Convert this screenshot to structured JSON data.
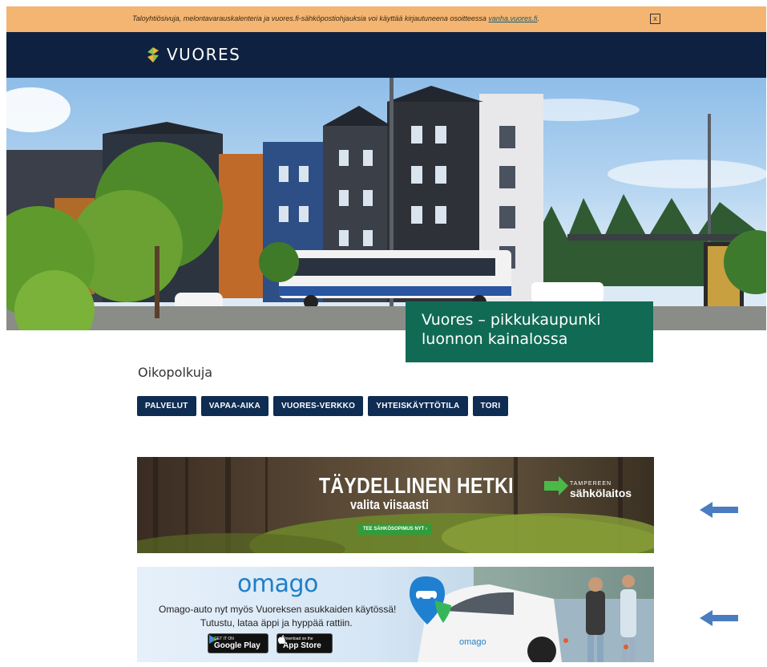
{
  "notice": {
    "text": "Taloyhtiösivuja, melontavarauskalenteria ja vuores.fi-sähköpostiohjauksia voi käyttää kirjautuneena osoitteessa ",
    "link_text": "vanha.vuores.fi",
    "suffix": ".",
    "close_label": "x"
  },
  "header": {
    "logo_text": "VUORES"
  },
  "hero": {
    "caption": "Vuores – pikkukaupunki luonnon kainalossa"
  },
  "shortcuts": {
    "title": "Oikopolkuja",
    "items": [
      {
        "label": "PALVELUT"
      },
      {
        "label": "VAPAA-AIKA"
      },
      {
        "label": "VUORES-VERKKO"
      },
      {
        "label": "YHTEISKÄYTTÖTILA"
      },
      {
        "label": "TORI"
      }
    ]
  },
  "ad_electricity": {
    "headline": "TÄYDELLINEN HETKI",
    "subline": "valita viisaasti",
    "cta": "TEE SÄHKÖSOPIMUS NYT  ›",
    "brand_top": "TAMPEREEN",
    "brand": "sähkölaitos"
  },
  "ad_omago": {
    "logo": "omago",
    "line1": "Omago-auto nyt myös Vuoreksen asukkaiden käytössä!",
    "line2": "Tutustu, lataa äppi ja hyppää rattiin.",
    "google_small": "GET IT ON",
    "google_big": "Google Play",
    "apple_small": "Download on the",
    "apple_big": "App Store",
    "car_logo": "omago"
  },
  "colors": {
    "notice_bg": "#f4b572",
    "header_bg": "#0f2140",
    "caption_bg": "#116b54",
    "button_bg": "#0f2c52",
    "arrow": "#4a7dc0"
  }
}
